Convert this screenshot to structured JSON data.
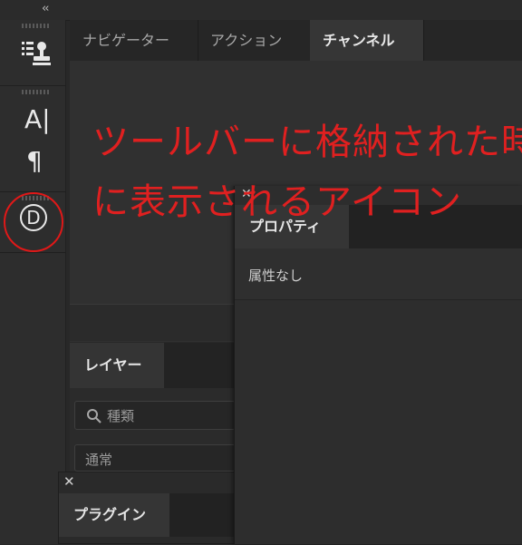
{
  "topbar": {
    "collapse_icon": "double-chevron-left"
  },
  "toolbar": {
    "icons": [
      "stamp-list-icon",
      "character-icon",
      "paragraph-icon",
      "d-circle-icon"
    ],
    "character_glyph": "A|",
    "paragraph_glyph": "¶",
    "d_glyph": "D"
  },
  "navigator_panel": {
    "tabs": [
      {
        "label": "ナビゲーター",
        "active": false
      },
      {
        "label": "アクション",
        "active": false
      },
      {
        "label": "チャンネル",
        "active": true
      }
    ]
  },
  "layers_panel": {
    "tab": "レイヤー",
    "search_placeholder": "種類",
    "blend_mode": "通常"
  },
  "plugin_panel": {
    "tab": "プラグイン"
  },
  "properties_panel": {
    "tab": "プロパティ",
    "empty_text": "属性なし"
  },
  "annotation": {
    "line1": "ツールバーに格納された時",
    "line2": "に表示されるアイコン",
    "color": "#e02020"
  }
}
